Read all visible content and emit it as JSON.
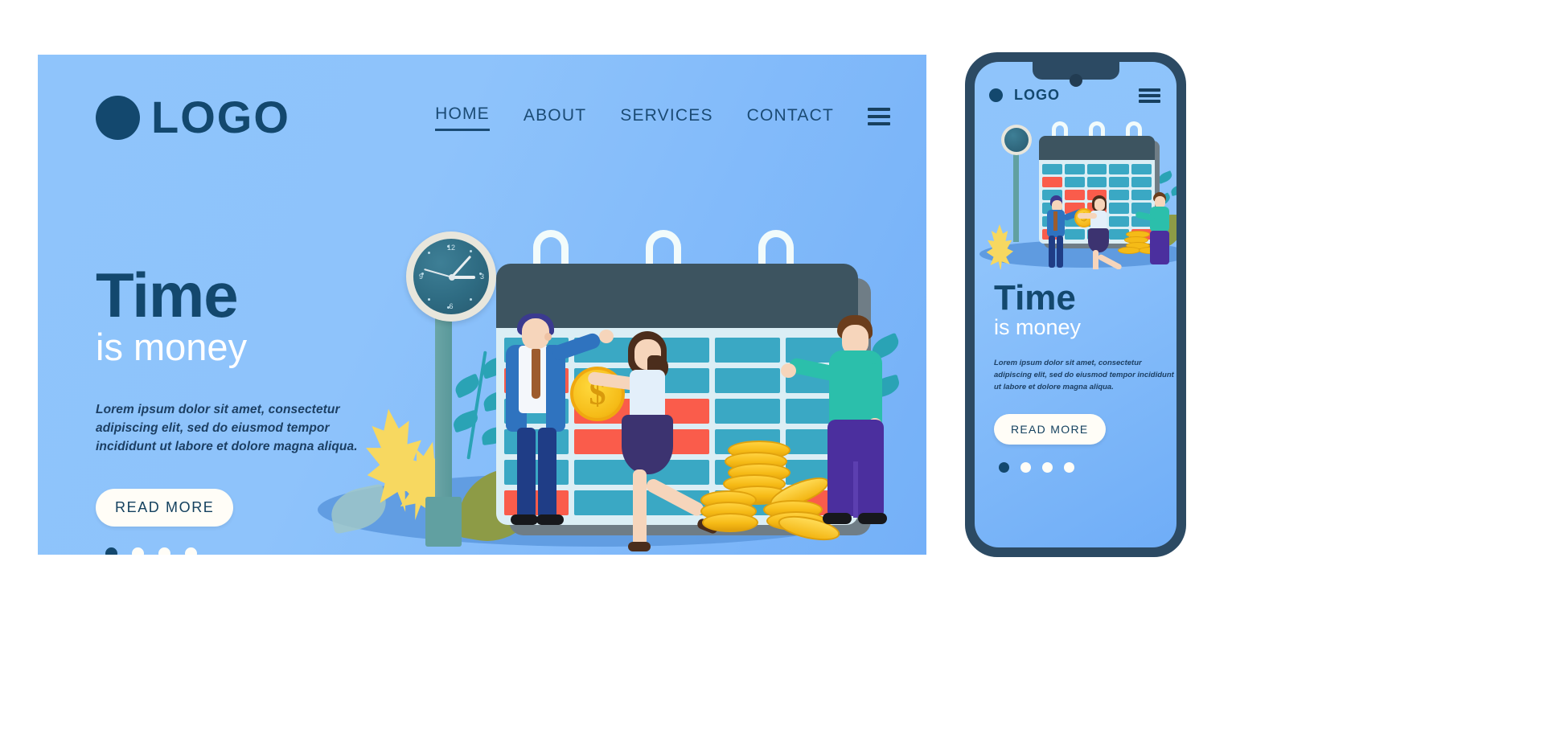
{
  "desktop": {
    "brand": {
      "name": "LOGO",
      "logo_icon": "circle-logo-mark"
    },
    "nav": {
      "items": [
        {
          "label": "HOME",
          "active": true
        },
        {
          "label": "ABOUT",
          "active": false
        },
        {
          "label": "SERVICES",
          "active": false
        },
        {
          "label": "CONTACT",
          "active": false
        }
      ],
      "menu_icon": "hamburger-menu-icon"
    },
    "hero": {
      "title": "Time",
      "subtitle": "is money",
      "paragraph": "Lorem ipsum dolor sit amet, consectetur adipiscing elit, sed do eiusmod tempor incididunt ut labore et dolore magna aliqua.",
      "cta_label": "READ MORE",
      "carousel": {
        "count": 4,
        "active_index": 0
      }
    },
    "illustration": {
      "clock": {
        "numerals": [
          "12",
          "3",
          "6",
          "9"
        ]
      },
      "coin_symbol": "$",
      "calendar": {
        "columns": 5,
        "rows": 6,
        "red_cells": [
          5,
          11,
          12,
          16,
          17,
          25,
          29
        ]
      }
    }
  },
  "mobile": {
    "brand": {
      "name": "LOGO",
      "logo_icon": "circle-logo-mark"
    },
    "menu_icon": "hamburger-menu-icon",
    "hero": {
      "title": "Time",
      "subtitle": "is money",
      "paragraph": "Lorem ipsum dolor sit amet, consectetur adipiscing elit, sed do eiusmod tempor incididunt ut labore et dolore magna aliqua.",
      "cta_label": "READ MORE",
      "carousel": {
        "count": 4,
        "active_index": 0
      }
    }
  },
  "colors": {
    "navy": "#13486e",
    "panel_blue_light": "#8fc4fb",
    "panel_blue_dark": "#74b0f8",
    "calendar_header": "#3d5460",
    "cell_teal": "#3aa8c4",
    "cell_red": "#fa5c4b",
    "coin_gold": "#f5bb17",
    "button_cream": "#fffdf7",
    "phone_bezel": "#2c4a63"
  }
}
